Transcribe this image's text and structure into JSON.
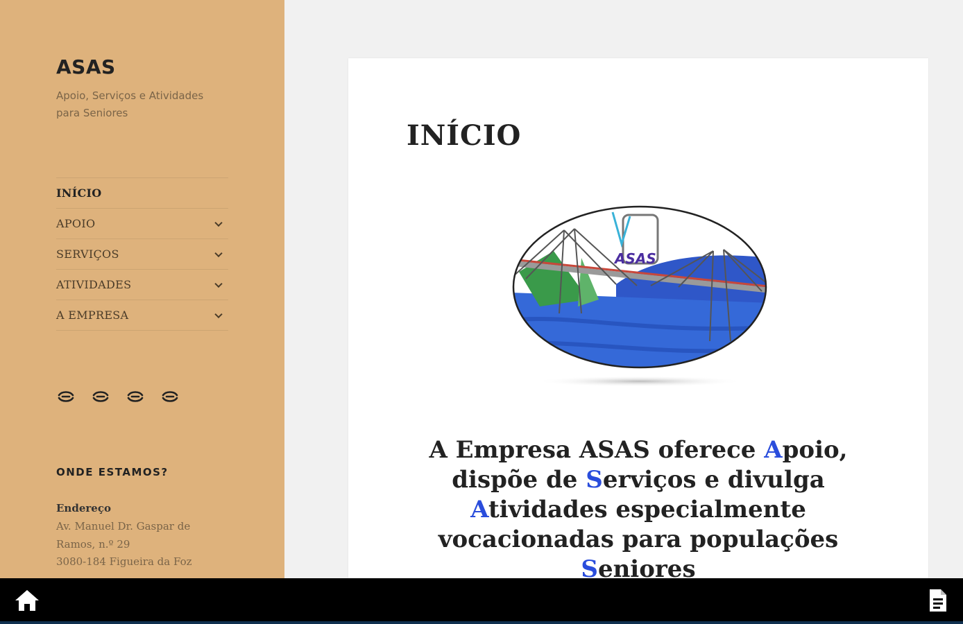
{
  "site": {
    "title": "ASAS",
    "description": "Apoio, Serviços e Atividades para Seniores"
  },
  "nav": {
    "items": [
      {
        "label": "INÍCIO",
        "has_submenu": false,
        "current": true
      },
      {
        "label": "APOIO",
        "has_submenu": true
      },
      {
        "label": "SERVIÇOS",
        "has_submenu": true
      },
      {
        "label": "ATIVIDADES",
        "has_submenu": true
      },
      {
        "label": "A EMPRESA",
        "has_submenu": true
      }
    ]
  },
  "social": {
    "icons": [
      "link-icon",
      "link-icon",
      "link-icon",
      "link-icon"
    ]
  },
  "widget": {
    "title": "ONDE ESTAMOS?",
    "address_label": "Endereço",
    "address_lines": [
      "Av. Manuel Dr. Gaspar de",
      "Ramos, n.º 29",
      "3080-184 Figueira da Foz"
    ]
  },
  "page": {
    "title": "INÍCIO",
    "logo_text": "ASAS",
    "lead": {
      "p1": "A Empresa ASAS oferece ",
      "c1": "A",
      "p2": "poio,",
      "p3": "dispõe de ",
      "c2": "S",
      "p4": "erviços e divulga",
      "c3": "A",
      "p5": "tividades especialmente",
      "p6": "vocacionadas para populações",
      "c4": "S",
      "p7": "eniores"
    }
  },
  "bottombar": {
    "icons": [
      "home-icon",
      "document-icon"
    ]
  },
  "colors": {
    "sidebar_bg": "#deb27c",
    "accent_letters": "#2a4ddc",
    "bottombar_bg": "#000000"
  }
}
